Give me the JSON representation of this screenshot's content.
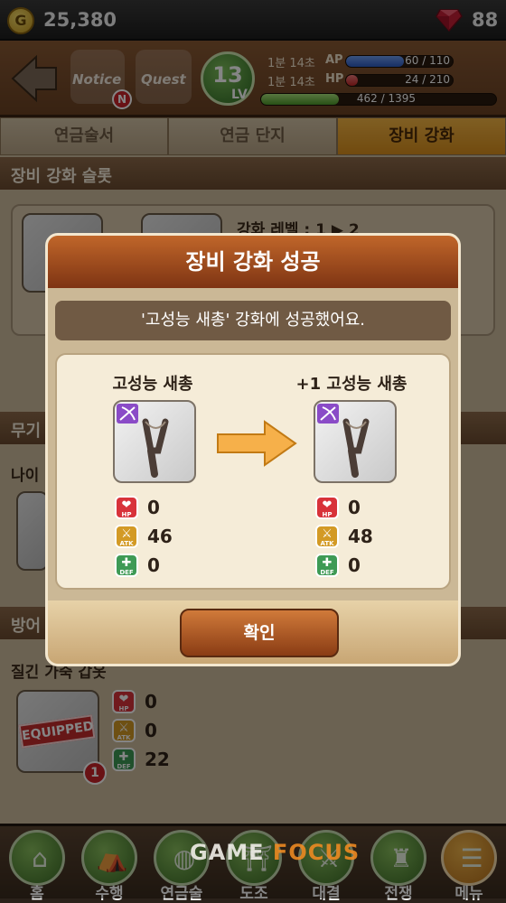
{
  "topbar": {
    "gold": "25,380",
    "coin_symbol": "G",
    "gems": "88"
  },
  "header": {
    "notice_label": "Notice",
    "notice_badge": "N",
    "quest_label": "Quest",
    "level": "13",
    "level_label": "LV",
    "ap": {
      "time": "1분 14초",
      "label": "AP",
      "value": "60 / 110",
      "fraction": 0.545
    },
    "hp": {
      "time": "1분 14초",
      "label": "HP",
      "value": "24 / 210",
      "fraction": 0.114
    },
    "exp": {
      "value": "462 / 1395",
      "fraction": 0.331
    }
  },
  "tabs": [
    {
      "label": "연금술서",
      "active": false
    },
    {
      "label": "연금 단지",
      "active": false
    },
    {
      "label": "장비 강화",
      "active": true
    }
  ],
  "background": {
    "section_slot": "장비 강화 슬롯",
    "enhance_level": "강화 레벨 : 1 ▶ 2",
    "section_weapon": "무기",
    "weapon_name": "나이",
    "section_armor": "방어",
    "armor_name": "질긴 가죽 갑옷",
    "equipped_tag": "EQUIPPED",
    "equipped_badge": "1",
    "armor_stats": {
      "hp": "0",
      "atk": "0",
      "def": "22"
    }
  },
  "modal": {
    "title": "장비 강화 성공",
    "message": "'고성능 새총' 강화에 성공했어요.",
    "before": {
      "name": "고성능 새총",
      "hp": "0",
      "atk": "46",
      "def": "0"
    },
    "after": {
      "name": "+1 고성능 새총",
      "hp": "0",
      "atk": "48",
      "def": "0"
    },
    "confirm_label": "확인"
  },
  "stat_icon_labels": {
    "hp": "HP",
    "atk": "ATK",
    "def": "DEF"
  },
  "bottom_nav": [
    {
      "label": "홈",
      "icon": "home-icon"
    },
    {
      "label": "수행",
      "icon": "tent-icon"
    },
    {
      "label": "연금술",
      "icon": "cauldron-icon"
    },
    {
      "label": "도조",
      "icon": "dojo-icon"
    },
    {
      "label": "대결",
      "icon": "swords-icon"
    },
    {
      "label": "전쟁",
      "icon": "castle-icon"
    },
    {
      "label": "메뉴",
      "icon": "menu-icon"
    }
  ],
  "watermark": {
    "line1": "GAME",
    "line2": "FOCUS"
  },
  "colors": {
    "accent": "#d98f1d",
    "modal_title": "#a2501f",
    "level": "#4f8f34",
    "ap_bar": "#3b6fd6",
    "hp_bar": "#d43b3b",
    "exp_bar": "#77c545"
  }
}
